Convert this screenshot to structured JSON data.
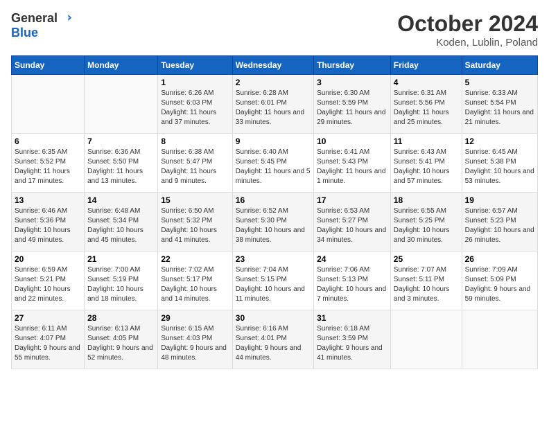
{
  "logo": {
    "general": "General",
    "blue": "Blue"
  },
  "title": {
    "month_year": "October 2024",
    "location": "Koden, Lublin, Poland"
  },
  "weekdays": [
    "Sunday",
    "Monday",
    "Tuesday",
    "Wednesday",
    "Thursday",
    "Friday",
    "Saturday"
  ],
  "weeks": [
    [
      {
        "day": null
      },
      {
        "day": null
      },
      {
        "day": 1,
        "sunrise": "Sunrise: 6:26 AM",
        "sunset": "Sunset: 6:03 PM",
        "daylight": "Daylight: 11 hours and 37 minutes."
      },
      {
        "day": 2,
        "sunrise": "Sunrise: 6:28 AM",
        "sunset": "Sunset: 6:01 PM",
        "daylight": "Daylight: 11 hours and 33 minutes."
      },
      {
        "day": 3,
        "sunrise": "Sunrise: 6:30 AM",
        "sunset": "Sunset: 5:59 PM",
        "daylight": "Daylight: 11 hours and 29 minutes."
      },
      {
        "day": 4,
        "sunrise": "Sunrise: 6:31 AM",
        "sunset": "Sunset: 5:56 PM",
        "daylight": "Daylight: 11 hours and 25 minutes."
      },
      {
        "day": 5,
        "sunrise": "Sunrise: 6:33 AM",
        "sunset": "Sunset: 5:54 PM",
        "daylight": "Daylight: 11 hours and 21 minutes."
      }
    ],
    [
      {
        "day": 6,
        "sunrise": "Sunrise: 6:35 AM",
        "sunset": "Sunset: 5:52 PM",
        "daylight": "Daylight: 11 hours and 17 minutes."
      },
      {
        "day": 7,
        "sunrise": "Sunrise: 6:36 AM",
        "sunset": "Sunset: 5:50 PM",
        "daylight": "Daylight: 11 hours and 13 minutes."
      },
      {
        "day": 8,
        "sunrise": "Sunrise: 6:38 AM",
        "sunset": "Sunset: 5:47 PM",
        "daylight": "Daylight: 11 hours and 9 minutes."
      },
      {
        "day": 9,
        "sunrise": "Sunrise: 6:40 AM",
        "sunset": "Sunset: 5:45 PM",
        "daylight": "Daylight: 11 hours and 5 minutes."
      },
      {
        "day": 10,
        "sunrise": "Sunrise: 6:41 AM",
        "sunset": "Sunset: 5:43 PM",
        "daylight": "Daylight: 11 hours and 1 minute."
      },
      {
        "day": 11,
        "sunrise": "Sunrise: 6:43 AM",
        "sunset": "Sunset: 5:41 PM",
        "daylight": "Daylight: 10 hours and 57 minutes."
      },
      {
        "day": 12,
        "sunrise": "Sunrise: 6:45 AM",
        "sunset": "Sunset: 5:38 PM",
        "daylight": "Daylight: 10 hours and 53 minutes."
      }
    ],
    [
      {
        "day": 13,
        "sunrise": "Sunrise: 6:46 AM",
        "sunset": "Sunset: 5:36 PM",
        "daylight": "Daylight: 10 hours and 49 minutes."
      },
      {
        "day": 14,
        "sunrise": "Sunrise: 6:48 AM",
        "sunset": "Sunset: 5:34 PM",
        "daylight": "Daylight: 10 hours and 45 minutes."
      },
      {
        "day": 15,
        "sunrise": "Sunrise: 6:50 AM",
        "sunset": "Sunset: 5:32 PM",
        "daylight": "Daylight: 10 hours and 41 minutes."
      },
      {
        "day": 16,
        "sunrise": "Sunrise: 6:52 AM",
        "sunset": "Sunset: 5:30 PM",
        "daylight": "Daylight: 10 hours and 38 minutes."
      },
      {
        "day": 17,
        "sunrise": "Sunrise: 6:53 AM",
        "sunset": "Sunset: 5:27 PM",
        "daylight": "Daylight: 10 hours and 34 minutes."
      },
      {
        "day": 18,
        "sunrise": "Sunrise: 6:55 AM",
        "sunset": "Sunset: 5:25 PM",
        "daylight": "Daylight: 10 hours and 30 minutes."
      },
      {
        "day": 19,
        "sunrise": "Sunrise: 6:57 AM",
        "sunset": "Sunset: 5:23 PM",
        "daylight": "Daylight: 10 hours and 26 minutes."
      }
    ],
    [
      {
        "day": 20,
        "sunrise": "Sunrise: 6:59 AM",
        "sunset": "Sunset: 5:21 PM",
        "daylight": "Daylight: 10 hours and 22 minutes."
      },
      {
        "day": 21,
        "sunrise": "Sunrise: 7:00 AM",
        "sunset": "Sunset: 5:19 PM",
        "daylight": "Daylight: 10 hours and 18 minutes."
      },
      {
        "day": 22,
        "sunrise": "Sunrise: 7:02 AM",
        "sunset": "Sunset: 5:17 PM",
        "daylight": "Daylight: 10 hours and 14 minutes."
      },
      {
        "day": 23,
        "sunrise": "Sunrise: 7:04 AM",
        "sunset": "Sunset: 5:15 PM",
        "daylight": "Daylight: 10 hours and 11 minutes."
      },
      {
        "day": 24,
        "sunrise": "Sunrise: 7:06 AM",
        "sunset": "Sunset: 5:13 PM",
        "daylight": "Daylight: 10 hours and 7 minutes."
      },
      {
        "day": 25,
        "sunrise": "Sunrise: 7:07 AM",
        "sunset": "Sunset: 5:11 PM",
        "daylight": "Daylight: 10 hours and 3 minutes."
      },
      {
        "day": 26,
        "sunrise": "Sunrise: 7:09 AM",
        "sunset": "Sunset: 5:09 PM",
        "daylight": "Daylight: 9 hours and 59 minutes."
      }
    ],
    [
      {
        "day": 27,
        "sunrise": "Sunrise: 6:11 AM",
        "sunset": "Sunset: 4:07 PM",
        "daylight": "Daylight: 9 hours and 55 minutes."
      },
      {
        "day": 28,
        "sunrise": "Sunrise: 6:13 AM",
        "sunset": "Sunset: 4:05 PM",
        "daylight": "Daylight: 9 hours and 52 minutes."
      },
      {
        "day": 29,
        "sunrise": "Sunrise: 6:15 AM",
        "sunset": "Sunset: 4:03 PM",
        "daylight": "Daylight: 9 hours and 48 minutes."
      },
      {
        "day": 30,
        "sunrise": "Sunrise: 6:16 AM",
        "sunset": "Sunset: 4:01 PM",
        "daylight": "Daylight: 9 hours and 44 minutes."
      },
      {
        "day": 31,
        "sunrise": "Sunrise: 6:18 AM",
        "sunset": "Sunset: 3:59 PM",
        "daylight": "Daylight: 9 hours and 41 minutes."
      },
      {
        "day": null
      },
      {
        "day": null
      }
    ]
  ]
}
